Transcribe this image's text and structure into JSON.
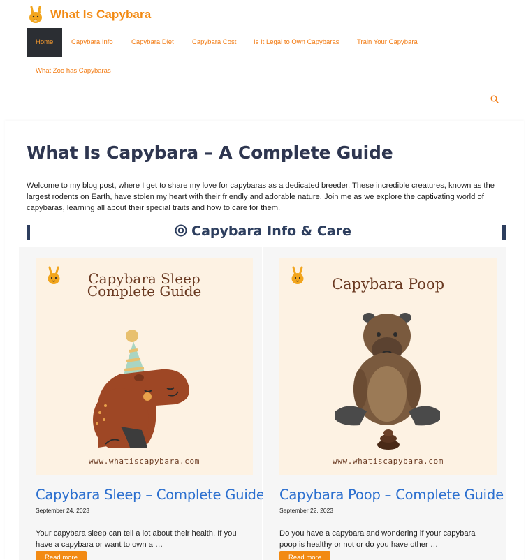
{
  "site": {
    "title": "What Is Capybara",
    "logo": "bunny-logo-icon",
    "accent_color": "#f28a13"
  },
  "nav": {
    "items": [
      {
        "label": "Home",
        "active": true
      },
      {
        "label": "Capybara Info"
      },
      {
        "label": "Capybara Diet"
      },
      {
        "label": "Capybara Cost"
      },
      {
        "label": "Is It Legal to Own Capybaras"
      },
      {
        "label": "Train Your Capybara"
      },
      {
        "label": "What Zoo has Capybaras"
      }
    ],
    "search_icon": "search-icon"
  },
  "page": {
    "title": "What Is Capybara – A Complete Guide",
    "intro": "Welcome to my blog post, where I get to share my love for capybaras as a dedicated breeder. These incredible creatures, known as the largest rodents on Earth, have stolen my heart with their friendly and adorable nature. Join me as we explore the captivating world of capybaras, learning all about their special traits and how to care for them."
  },
  "section": {
    "heading": "Capybara Info & Care",
    "icon": "target-icon"
  },
  "posts": [
    {
      "image_title_line1": "Capybara Sleep",
      "image_title_line2": "Complete Guide",
      "image_url": "www.whatiscapybara.com",
      "title": "Capybara Sleep – Complete Guide",
      "date": "September 24, 2023",
      "excerpt": "Your capybara sleep can tell a lot about their health. If you have a capybara or want to own a …",
      "read_more": "Read more"
    },
    {
      "image_title_line1": "Capybara Poop",
      "image_url": "www.whatiscapybara.com",
      "title": "Capybara Poop – Complete Guide",
      "date": "September 22, 2023",
      "excerpt": "Do you have a capybara and wondering if your capybara poop is healthy or not or do you have other …",
      "read_more": "Read more"
    }
  ]
}
